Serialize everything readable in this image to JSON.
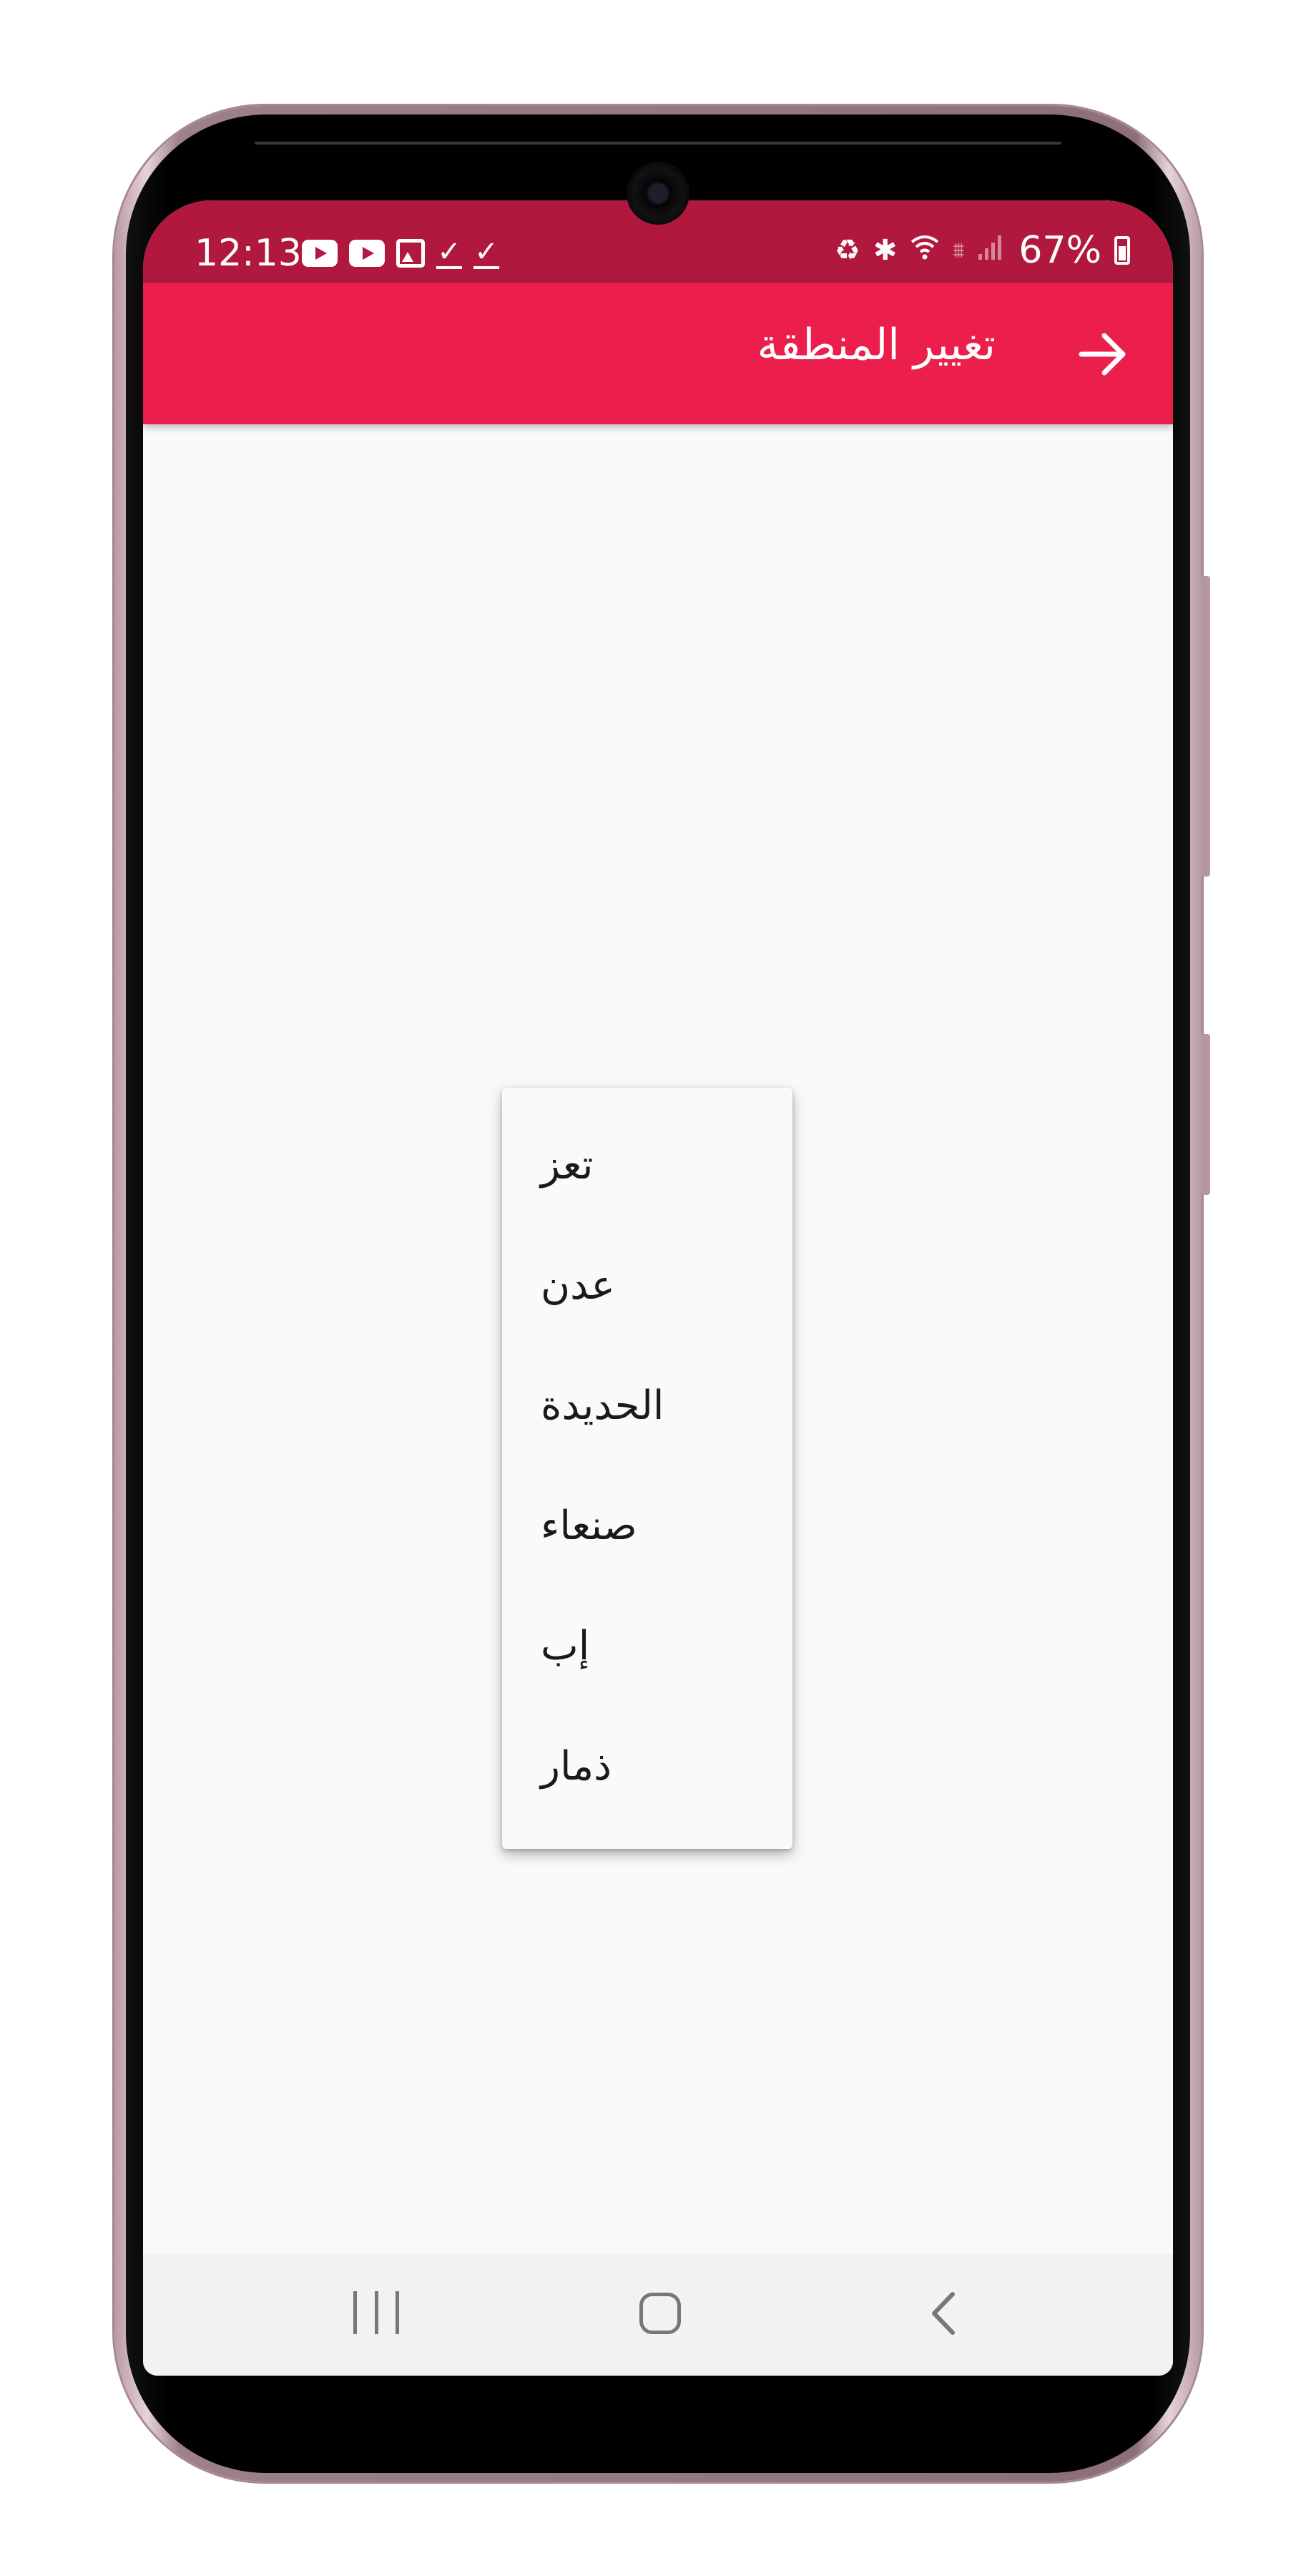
{
  "status_bar": {
    "time": "12:13",
    "battery_percent": "67%",
    "icons_left": [
      "youtube-icon",
      "youtube-icon",
      "gallery-icon",
      "check-icon",
      "check-icon"
    ],
    "icons_right": [
      "battery-saver-icon",
      "bluetooth-icon",
      "wifi-icon",
      "lte-icon",
      "signal-icon",
      "battery-icon"
    ]
  },
  "app_bar": {
    "title": "تغيير المنطقة",
    "back_icon": "arrow-right-icon",
    "color": "#ec1e4c"
  },
  "menu": {
    "items": [
      "تعز",
      "عدن",
      "الحديدة",
      "صنعاء",
      "إب",
      "ذمار"
    ]
  },
  "nav_bar": {
    "buttons": [
      "recents-icon",
      "home-icon",
      "back-icon"
    ]
  },
  "colors": {
    "status_bar": "#b0183d",
    "app_bar": "#ec1e4c",
    "background": "#f9f9f9"
  }
}
